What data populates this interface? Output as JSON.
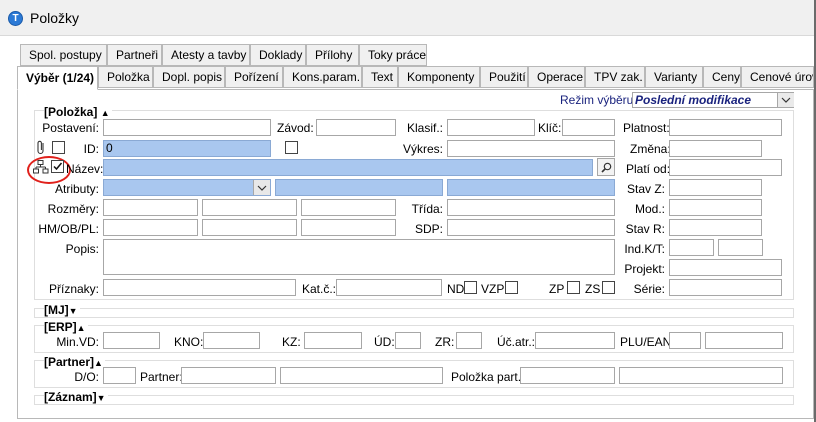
{
  "window": {
    "title": "Položky",
    "icon_letter": "T"
  },
  "tabs_row1": [
    "Spol. postupy",
    "Partneři",
    "Atesty a tavby",
    "Doklady",
    "Přílohy",
    "Toky práce"
  ],
  "tabs_row2": [
    "Výběr (1/24)",
    "Položka",
    "Dopl. popis",
    "Pořízení",
    "Kons.param.",
    "Text",
    "Komponenty",
    "Použití",
    "Operace",
    "TPV zak.",
    "Varianty",
    "Ceny",
    "Cenové úrov"
  ],
  "rezim": {
    "label": "Režim výběru:",
    "value": "Poslední modifikace"
  },
  "sections": {
    "polozka": "[Položka]",
    "mj": "[MJ]",
    "erp": "[ERP]",
    "partner": "[Partner]",
    "zaznam": "[Záznam]"
  },
  "labels": {
    "postaveni": "Postavení:",
    "zavod": "Závod:",
    "klasif": "Klasif.:",
    "klic": "Klíč:",
    "platnost": "Platnost:",
    "id": "ID:",
    "vykres": "Výkres:",
    "zmena": "Změna:",
    "nazev": "Název:",
    "plati_od": "Platí od:",
    "atributy": "Atributy:",
    "stav_z": "Stav Z:",
    "rozmery": "Rozměry:",
    "trida": "Třída:",
    "mod": "Mod.:",
    "hm": "HM/OB/PL:",
    "sdp": "SDP:",
    "stav_r": "Stav R:",
    "popis": "Popis:",
    "ind_kt": "Ind.K/T:",
    "projekt": "Projekt:",
    "priznaky": "Příznaky:",
    "kat_c": "Kat.č.:",
    "nd": "ND",
    "vzp": "VZP",
    "zp": "ZP",
    "zs": "ZS",
    "serie": "Série:",
    "min_vd": "Min.VD:",
    "kno": "KNO:",
    "kz": "KZ:",
    "ud": "ÚD:",
    "zr": "ZR:",
    "uc_atr": "Úč.atr.:",
    "plu_ean": "PLU/EAN:",
    "do": "D/O:",
    "partner": "Partner:",
    "polozka_part": "Položka part.:"
  },
  "values": {
    "id": "0"
  },
  "colors": {
    "highlight_field": "#a9c7ef",
    "annotation_circle": "#e0201b",
    "accent_text": "#1a237e"
  },
  "icons": {
    "app": "app-logo-icon",
    "attachment": "paperclip-icon",
    "tree": "tree-hierarchy-icon",
    "search": "search-icon",
    "dropdown": "chevron-down-icon"
  }
}
